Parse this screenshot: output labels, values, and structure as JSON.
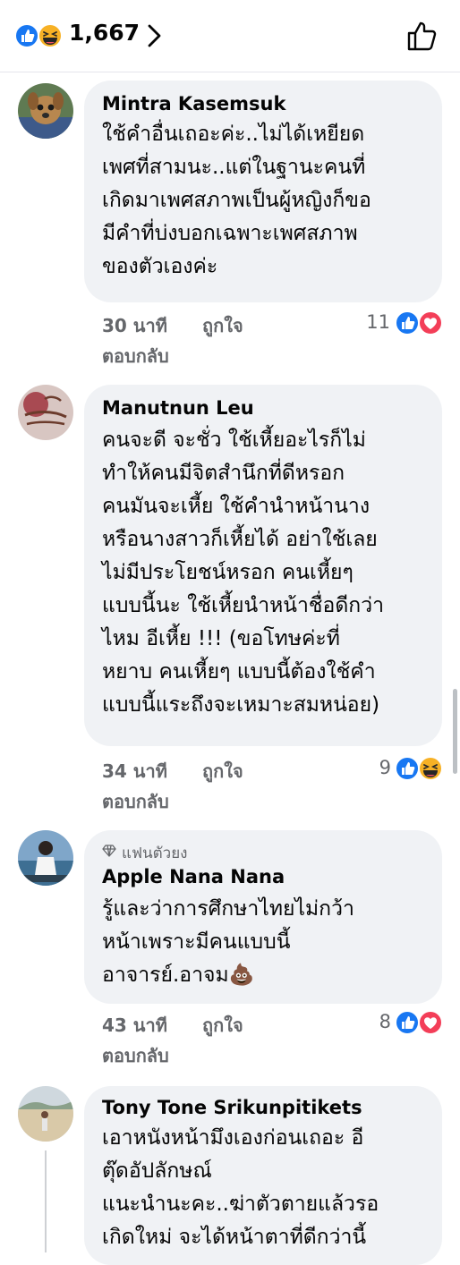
{
  "header": {
    "reaction_count": "1,667",
    "reaction_icons": [
      "like-icon",
      "haha-icon"
    ]
  },
  "comments": [
    {
      "author": "Mintra Kasemsuk",
      "badge": "",
      "lines": [
        "ใช้คำอื่นเถอะค่ะ..ไม่ได้เหยียด",
        "เพศที่สามนะ..แต่ในฐานะคนที่",
        "เกิดมาเพศสภาพเป็นผู้หญิงก็ขอ",
        "มีคำที่บ่งบอกเฉพาะเพศสภาพ",
        "ของตัวเองค่ะ"
      ],
      "time": "30 นาที",
      "like_label": "ถูกใจ",
      "reply_label": "ตอบกลับ",
      "reaction_count": "11",
      "reactions": [
        "like-icon",
        "love-icon"
      ]
    },
    {
      "author": "Manutnun Leu",
      "badge": "",
      "lines": [
        "คนจะดี จะชั่ว ใช้เหี้ยอะไรก็ไม่",
        "ทำให้คนมีจิตสำนึกที่ดีหรอก",
        "คนมันจะเหี้ย ใช้คำนำหน้านาง",
        "หรือนางสาวก็เหี้ยได้ อย่าใช้เลย",
        "ไม่มีประโยชน์หรอก คนเหี้ยๆ",
        "แบบนี้นะ ใช้เหี้ยนำหน้าชื่อดีกว่า",
        "ไหม อีเหี้ย !!! (ขอโทษค่ะที่",
        "หยาบ คนเหี้ยๆ แบบนี้ต้องใช้คำ",
        "แบบนี้แระถึงจะเหมาะสมหน่อย)"
      ],
      "time": "34 นาที",
      "like_label": "ถูกใจ",
      "reply_label": "ตอบกลับ",
      "reaction_count": "9",
      "reactions": [
        "like-icon",
        "haha-icon"
      ]
    },
    {
      "author": "Apple Nana Nana",
      "badge": "แฟนตัวยง",
      "lines": [
        "รู้และว่าการศึกษาไทยไม่กว้า",
        "หน้าเพราะมีคนแบบนี้",
        "อาจารย์.อาจม💩"
      ],
      "time": "43 นาที",
      "like_label": "ถูกใจ",
      "reply_label": "ตอบกลับ",
      "reaction_count": "8",
      "reactions": [
        "like-icon",
        "love-icon"
      ]
    },
    {
      "author": "Tony Tone Srikunpitikets",
      "badge": "",
      "lines": [
        "เอาหนังหน้ามึงเองก่อนเถอะ อี",
        "ตุ๊ดอัปลักษณ์",
        "แนะนำนะคะ..ฆ่าตัวตายแล้วรอ",
        "เกิดใหม่ จะได้หน้าตาที่ดีกว่านี้"
      ]
    }
  ],
  "colors": {
    "like_blue": "#1877f2",
    "love_red": "#f33e58",
    "haha_yellow": "#f7b125",
    "bubble_bg": "#f0f2f5",
    "meta_gray": "#65676b"
  }
}
